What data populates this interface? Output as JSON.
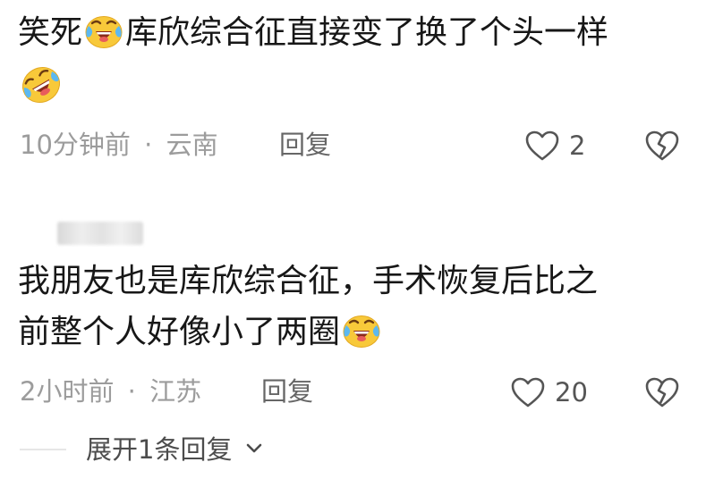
{
  "comments": [
    {
      "text_before_emoji": "笑死",
      "text_after_emoji": "库欣综合征直接变了换了个头一样",
      "inline_emojis": [
        "crying-laughing-emoji",
        "rolling-laughing-emoji"
      ],
      "time": "10分钟前",
      "separator": "·",
      "location": "云南",
      "reply_label": "回复",
      "like_count": "2"
    },
    {
      "username": "",
      "line1": "我朋友也是库欣综合征，手术恢复后比之",
      "line2": "前整个人好像小了两圈",
      "inline_emojis": [
        "crying-laughing-emoji"
      ],
      "time": "2小时前",
      "separator": "·",
      "location": "江苏",
      "reply_label": "回复",
      "like_count": "20",
      "expand_replies_label": "展开1条回复"
    }
  ],
  "icons": {
    "like": "heart-outline-icon",
    "dislike": "broken-heart-icon",
    "expand": "chevron-down-icon"
  },
  "colors": {
    "text": "#171717",
    "meta": "#9c9c9c",
    "icon": "#555555",
    "emoji_face": "#f8c93a"
  }
}
